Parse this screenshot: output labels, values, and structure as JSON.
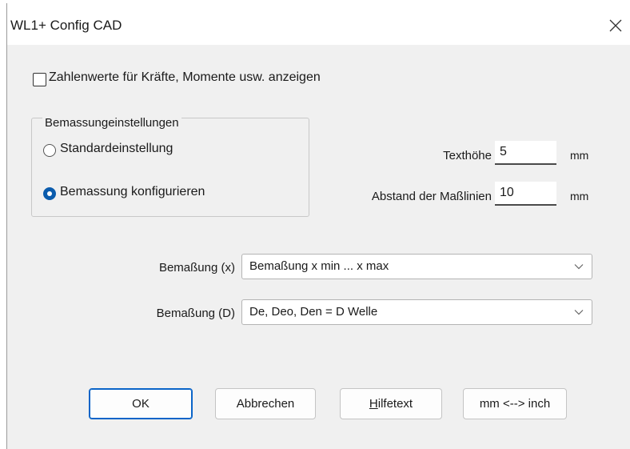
{
  "window": {
    "title": "WL1+ Config CAD",
    "close_glyph": "✕"
  },
  "options": {
    "show_values_label": "Zahlenwerte für Kräfte, Momente usw. anzeigen",
    "show_values_checked": false
  },
  "dimensioning_group": {
    "legend": "Bemassungeinstellungen",
    "radios": [
      {
        "label": "Standardeinstellung",
        "selected": false
      },
      {
        "label": "Bemassung konfigurieren",
        "selected": true
      }
    ]
  },
  "fields": {
    "text_height": {
      "label": "Texthöhe",
      "value": "5",
      "unit": "mm"
    },
    "line_spacing": {
      "label": "Abstand der Maßlinien",
      "value": "10",
      "unit": "mm"
    }
  },
  "dropdowns": {
    "x": {
      "label": "Bemaßung (x)",
      "value": "Bemaßung x min ... x max"
    },
    "d": {
      "label": "Bemaßung (D)",
      "value": "De, Deo, Den = D Welle"
    }
  },
  "buttons": {
    "ok": "OK",
    "cancel": "Abbrechen",
    "help_first": "H",
    "help_rest": "ilfetext",
    "convert": "mm <--> inch"
  },
  "icons": {
    "close": "close-icon",
    "dropdown": "chevron-down-icon"
  },
  "colors": {
    "accent": "#0b5cad",
    "dialog_bg": "#f0f0f0",
    "titlebar_bg": "#ffffff"
  }
}
